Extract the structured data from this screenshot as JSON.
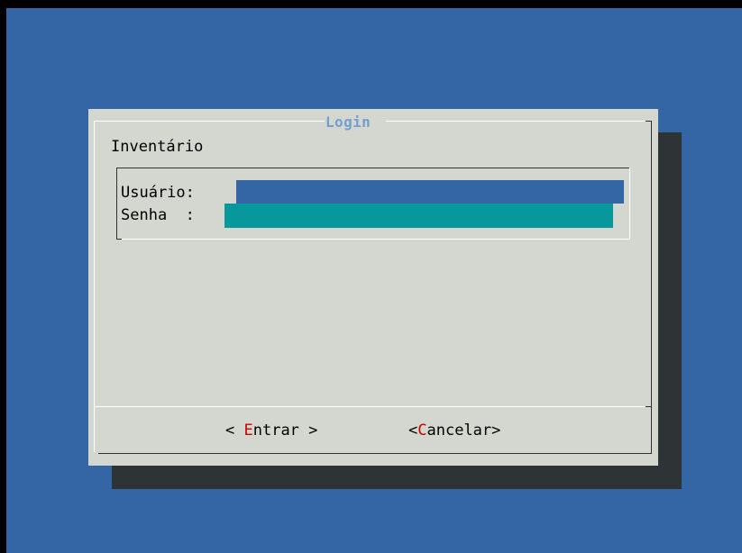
{
  "dialog": {
    "title": "Login",
    "subtitle": "Inventário"
  },
  "form": {
    "user_label": "Usuário:",
    "user_value": "",
    "pass_label": "Senha  :",
    "pass_value": ""
  },
  "buttons": {
    "ok": {
      "left": "< ",
      "hotkey": "E",
      "rest": "ntrar >"
    },
    "cancel": {
      "left": "<",
      "hotkey": "C",
      "rest": "ancelar>"
    }
  },
  "colors": {
    "background": "#3465a4",
    "dialog": "#d3d7cf",
    "shadow": "#2e3436",
    "title": "#729fcf",
    "active_field": "#3465a4",
    "inactive_field": "#06989a",
    "hotkey": "#cc0000"
  }
}
